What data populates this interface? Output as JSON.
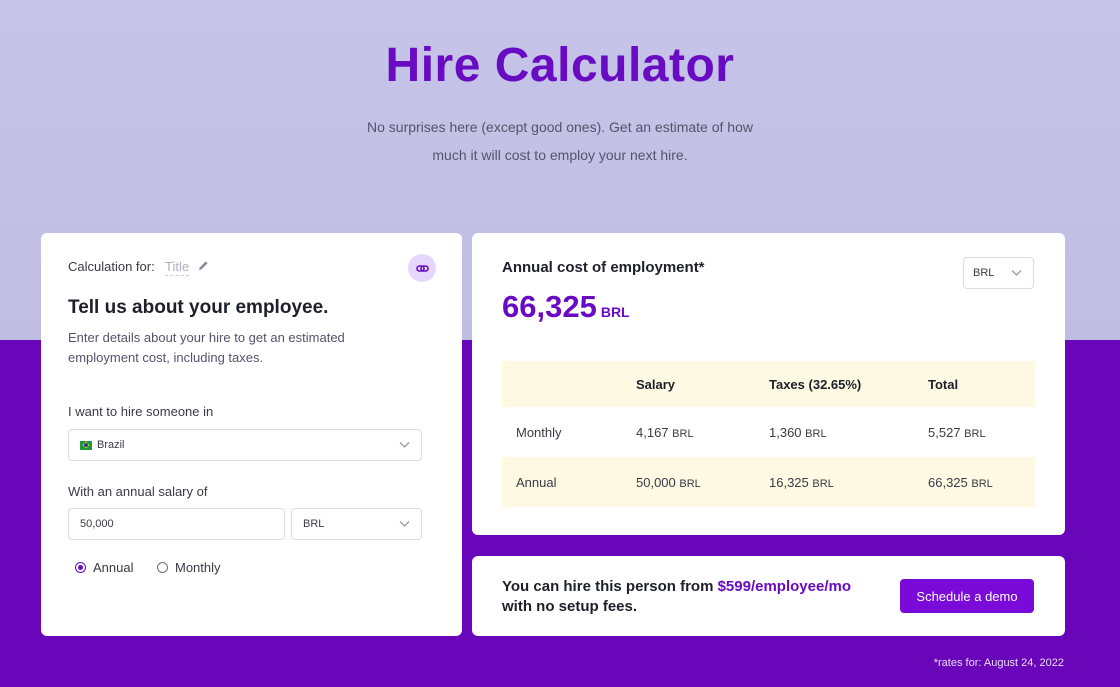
{
  "header": {
    "title": "Hire Calculator",
    "subtitle_line1": "No surprises here (except good ones). Get an estimate of how",
    "subtitle_line2": "much it will cost to employ your next hire."
  },
  "form": {
    "calc_for_label": "Calculation for:",
    "title_placeholder": "Title",
    "heading": "Tell us about your employee.",
    "description": "Enter details about your hire to get an estimated employment cost, including taxes.",
    "country_label": "I want to hire someone in",
    "country_value": "Brazil",
    "salary_label": "With an annual salary of",
    "salary_value": "50,000",
    "salary_currency": "BRL",
    "period_options": [
      "Annual",
      "Monthly"
    ],
    "period_selected": "Annual"
  },
  "result": {
    "label": "Annual cost of employment*",
    "currency": "BRL",
    "amount": "66,325",
    "amount_unit": "BRL",
    "table": {
      "headers": [
        "",
        "Salary",
        "Taxes (32.65%)",
        "Total"
      ],
      "rows": [
        {
          "label": "Monthly",
          "salary": "4,167",
          "taxes": "1,360",
          "total": "5,527",
          "unit": "BRL"
        },
        {
          "label": "Annual",
          "salary": "50,000",
          "taxes": "16,325",
          "total": "66,325",
          "unit": "BRL"
        }
      ]
    }
  },
  "cta": {
    "text_before": "You can hire this person from ",
    "price": "$599/employee/mo",
    "text_after": "with no setup fees.",
    "button": "Schedule a demo"
  },
  "footnote": "*rates for: August 24, 2022",
  "colors": {
    "accent": "#6a0bc4",
    "band": "#6a06b9",
    "hero": "#c6c4e8",
    "table_shade": "#fdf9e3"
  }
}
